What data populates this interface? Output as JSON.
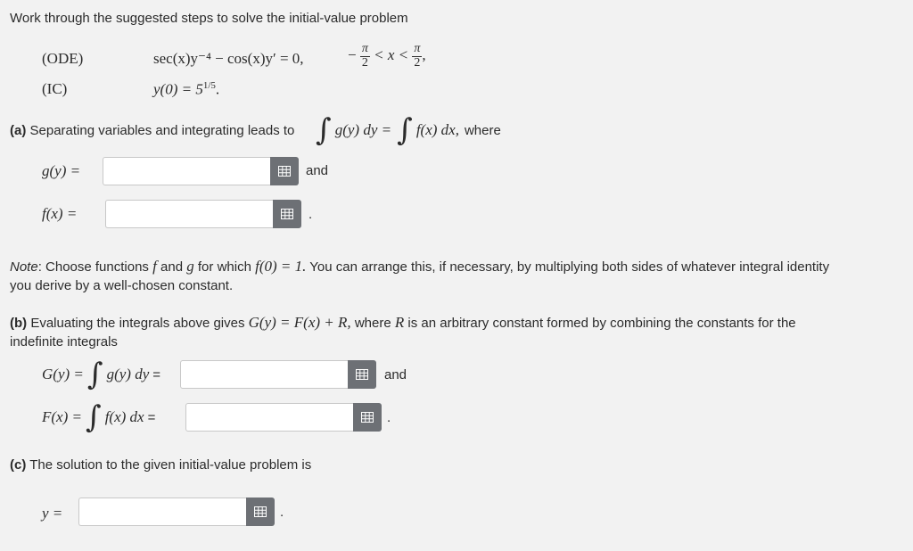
{
  "intro": "Work through the suggested steps to solve the initial-value problem",
  "problem": {
    "ode_label": "(ODE)",
    "ic_label": "(IC)",
    "ode_eq": "sec(x)y⁻⁴ − cos(x)y′ = 0,",
    "domain_left": "−",
    "pi": "π",
    "two": "2",
    "domain_mid": "< x <",
    "domain_end": ",",
    "ic_eq": "y(0) = 5",
    "ic_exp": "1/5",
    "ic_end": "."
  },
  "part_a": {
    "label": "(a)",
    "text": "Separating variables and integrating leads to",
    "integral_left": "g(y) dy =",
    "integral_right": "f(x) dx,",
    "where": "where",
    "g_label": "g(y) =",
    "f_label": "f(x) =",
    "and": "and",
    "period": "."
  },
  "note": {
    "label": "Note",
    "line1_a": ": Choose functions",
    "f": "f",
    "and": "and",
    "g": "g",
    "line1_b": "for which",
    "cond": "f(0) = 1.",
    "line1_c": "You can arrange this, if necessary, by multiplying both sides of whatever integral identity",
    "line2": "you derive by a well-chosen constant."
  },
  "part_b": {
    "label": "(b)",
    "text1": "Evaluating the integrals above gives",
    "eq": "G(y) = F(x) + R,",
    "text2": "where",
    "R": "R",
    "text3": "is an arbitrary constant formed by combining the constants for the",
    "line2": "indefinite integrals",
    "G_label": "G(y) =",
    "G_integrand": "g(y) dy",
    "F_label": "F(x) =",
    "F_integrand": "f(x) dx",
    "eqsign": "=",
    "and": "and",
    "period": "."
  },
  "part_c": {
    "label": "(c)",
    "text": "The solution to the given initial-value problem is",
    "y_label": "y =",
    "period": "."
  },
  "inputs": {
    "g_value": "",
    "f_value": "",
    "G_value": "",
    "F_value": "",
    "y_value": ""
  },
  "icons": {
    "keyboard": "keyboard-icon"
  }
}
